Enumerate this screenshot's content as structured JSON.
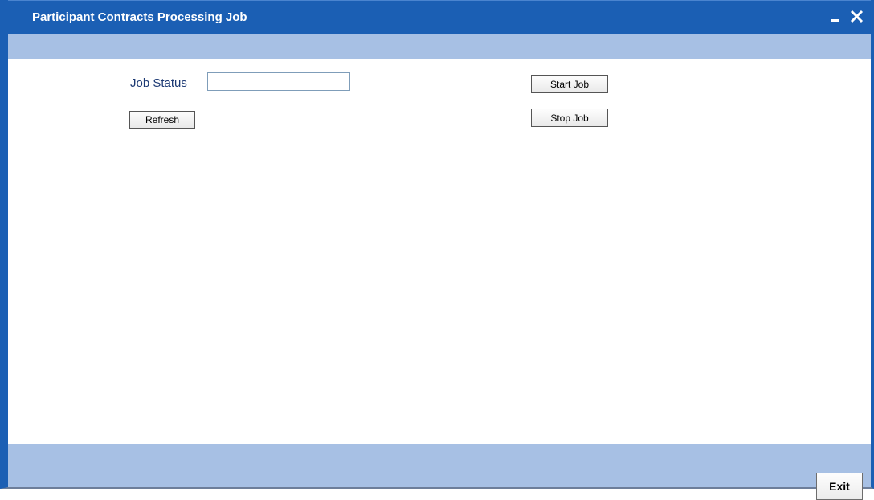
{
  "window": {
    "title": "Participant Contracts Processing Job",
    "controls": {
      "minimize_icon": "minimize-icon",
      "close_icon": "close-icon"
    }
  },
  "form": {
    "job_status_label": "Job Status",
    "job_status_value": "",
    "job_status_placeholder": "",
    "refresh_label": "Refresh",
    "start_job_label": "Start Job",
    "stop_job_label": "Stop Job"
  },
  "footer": {
    "exit_label": "Exit"
  },
  "colors": {
    "titlebar": "#1b5fb4",
    "toolbar": "#a7c0e4",
    "label_text": "#1d3a74"
  }
}
